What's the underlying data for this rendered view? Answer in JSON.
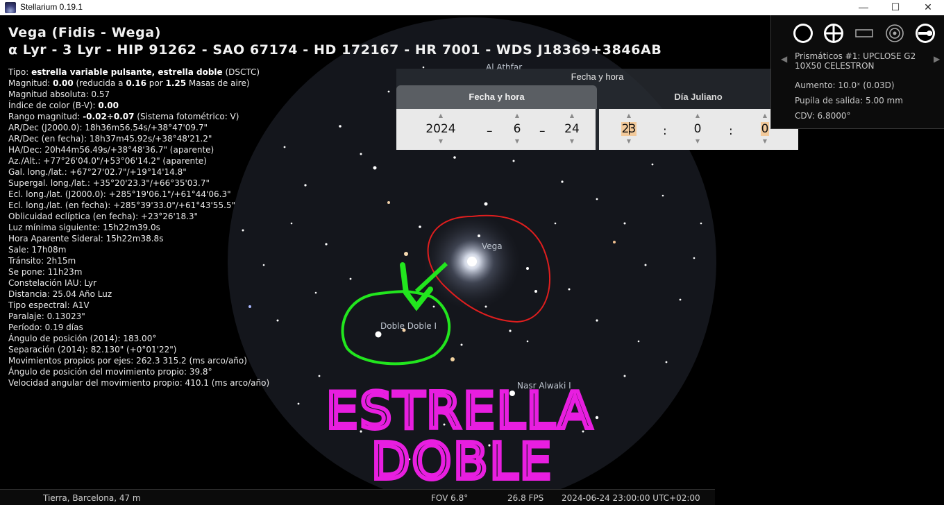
{
  "window": {
    "title": "Stellarium 0.19.1",
    "minimize": "—",
    "maximize": "☐",
    "close": "✕"
  },
  "object": {
    "name": "Vega (Fidis - Wega)",
    "ids": "α Lyr - 3 Lyr - HIP 91262 - SAO 67174 - HD 172167 - HR 7001 - WDS J18369+3846AB"
  },
  "info": {
    "tipo_label": "Tipo: ",
    "tipo_value": "estrella variable pulsante, estrella doble",
    "tipo_suffix": " (DSCTC)",
    "mag_label": "Magnitud: ",
    "mag_value": "0.00",
    "mag_mid1": " (reducida a ",
    "mag_red": "0.16",
    "mag_mid2": " por ",
    "mag_air": "1.25",
    "mag_tail": " Masas de aire)",
    "abs_mag": "Magnitud absoluta: 0.57",
    "color_label": "Índice de color (B-V): ",
    "color_value": "0.00",
    "range_label": "Rango magnitud: ",
    "range_value": "-0.02÷0.07",
    "range_tail": " (Sistema fotométrico: V)",
    "lines": [
      "AR/Dec (J2000.0): 18h36m56.54s/+38°47'09.7\"",
      "AR/Dec (en fecha): 18h37m45.92s/+38°48'21.2\"",
      "HA/Dec: 20h44m56.49s/+38°48'36.7\" (aparente)",
      "Az./Alt.: +77°26'04.0\"/+53°06'14.2\" (aparente)",
      "Gal. long./lat.: +67°27'02.7\"/+19°14'14.8\"",
      "Supergal. long./lat.: +35°20'23.3\"/+66°35'03.7\"",
      "Ecl. long./lat. (J2000.0): +285°19'06.1\"/+61°44'06.3\"",
      "Ecl. long./lat. (en fecha): +285°39'33.0\"/+61°43'55.5\"",
      "Oblicuidad eclíptica (en fecha): +23°26'18.3\"",
      "Luz mínima siguiente: 15h22m39.0s",
      "Hora Aparente Sideral: 15h22m38.8s",
      "Sale: 17h08m",
      "Tránsito: 2h15m",
      "Se pone: 11h23m",
      "Constelación IAU: Lyr",
      "Distancia: 25.04 Año Luz",
      "Tipo espectral: A1V",
      "Paralaje: 0.13023\"",
      "Período: 0.19 días",
      "Ángulo de posición (2014): 183.00°",
      "Separación (2014): 82.130\" (+0°01'22\")",
      "Movimientos propios por ejes: 262.3 315.2 (ms arco/año)",
      "Ángulo de posición del movimiento propio: 39.8°",
      "Velocidad angular del movimiento propio: 410.1 (ms arco/año)"
    ]
  },
  "dialog": {
    "title": "Fecha y hora",
    "close": "✕",
    "tab_date": "Fecha y hora",
    "tab_jd": "Día Juliano",
    "year": "2024",
    "month": "6",
    "day": "24",
    "hour_a": "2",
    "hour_b": "3",
    "minute": "0",
    "second": "0",
    "date_sep": "–",
    "time_sep": ":",
    "arrow_up": "▲",
    "arrow_down": "▼"
  },
  "ocular": {
    "name_line1": "Prismáticos #1: UPCLOSE G2",
    "name_line2": "10X50 CELESTRON",
    "aumento": "Aumento: 10.0ˣ (0.03D)",
    "pupila": "Pupila de salida: 5.00 mm",
    "cdv": "CDV: 6.8000°",
    "prev": "◀",
    "next": "▶"
  },
  "sky_labels": {
    "vega": "Vega",
    "doble": "Doble Doble I",
    "nasr": "Nasr Alwaki I",
    "athfar": "Al Athfar"
  },
  "annotation": {
    "line1": "ESTRELLA",
    "line2": "DOBLE"
  },
  "status": {
    "location": "Tierra, Barcelona, 47 m",
    "fov": "FOV 6.8°",
    "fps": "26.8 FPS",
    "datetime": "2024-06-24 23:00:00 UTC+02:00"
  },
  "colors": {
    "annotation_magenta": "#e81ee0",
    "annotation_green": "#22e61e",
    "annotation_red": "#e01e1e",
    "highlight": "#f2c99a"
  }
}
